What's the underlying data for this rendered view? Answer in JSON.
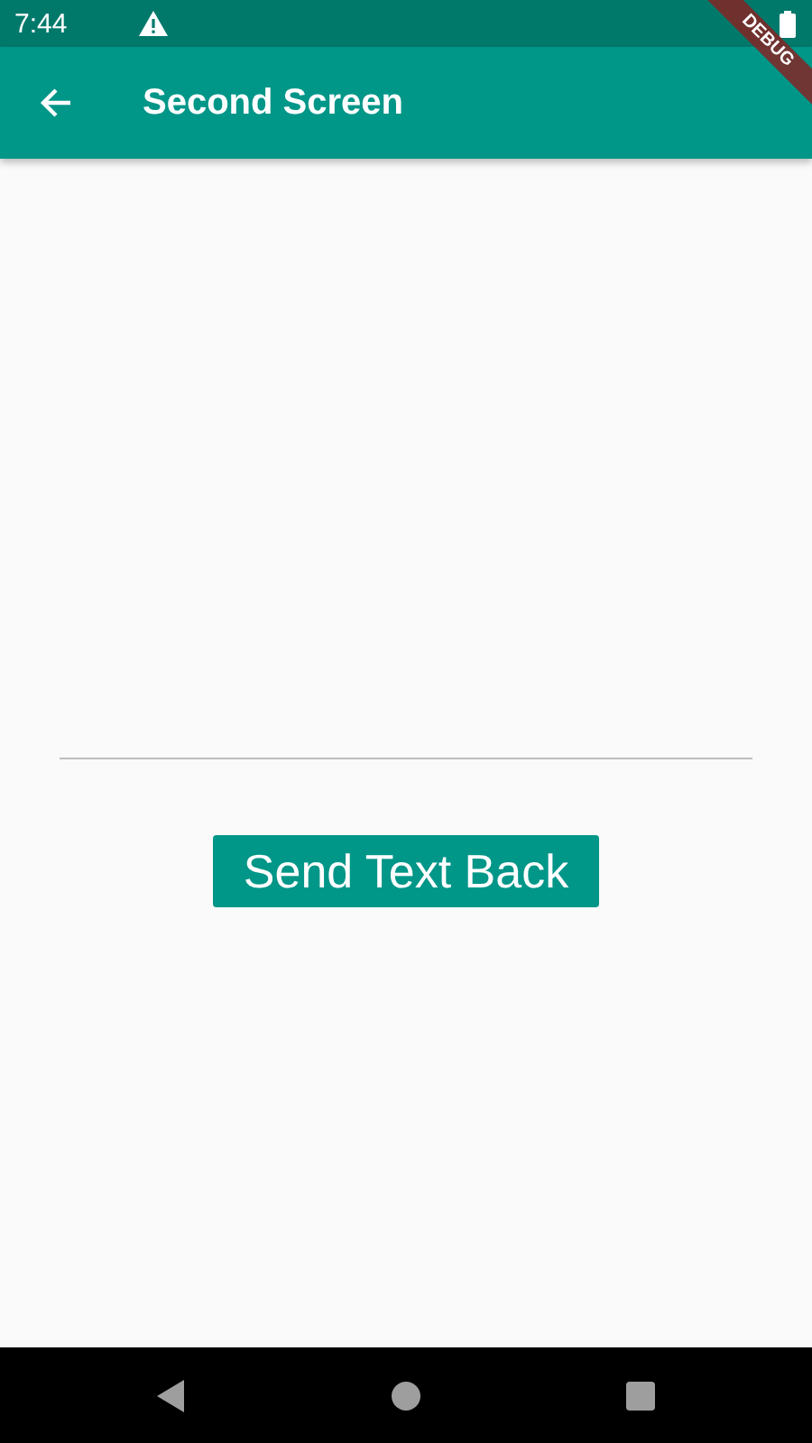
{
  "status_bar": {
    "time": "7:44"
  },
  "debug_banner": {
    "label": "DEBUG"
  },
  "app_bar": {
    "title": "Second Screen"
  },
  "send_button": {
    "label": "Send Text Back"
  }
}
